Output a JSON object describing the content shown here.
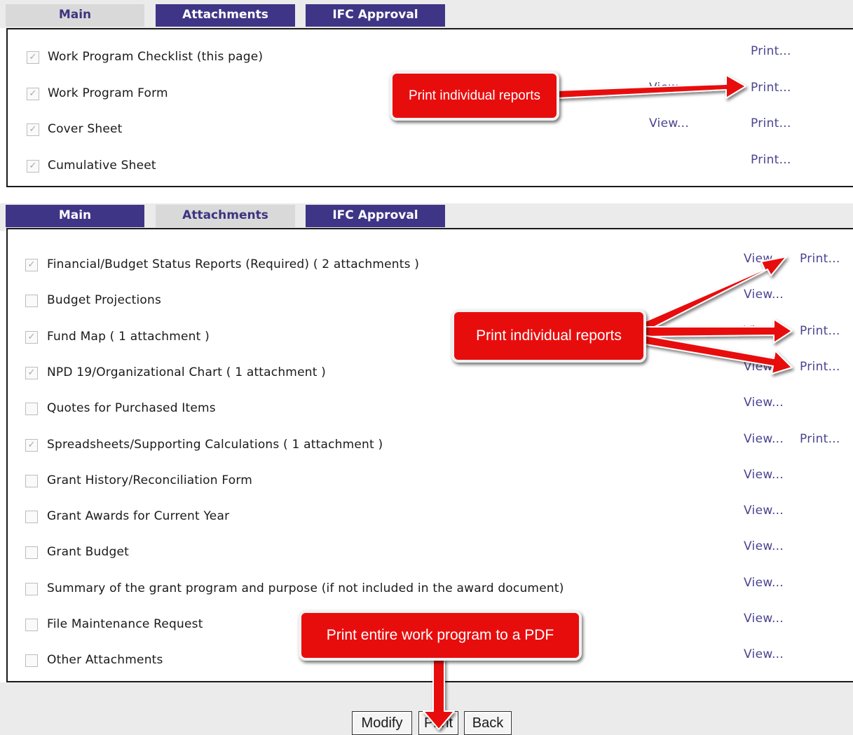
{
  "tabs_top": {
    "main": "Main",
    "attachments": "Attachments",
    "ifc": "IFC Approval",
    "active": "main"
  },
  "tabs_bottom": {
    "main": "Main",
    "attachments": "Attachments",
    "ifc": "IFC Approval",
    "active": "attachments"
  },
  "main_items": [
    {
      "label": "Work Program Checklist (this page)",
      "checked": true,
      "view": "",
      "print": "Print..."
    },
    {
      "label": "Work Program Form",
      "checked": true,
      "view": "View...",
      "print": "Print..."
    },
    {
      "label": "Cover Sheet",
      "checked": true,
      "view": "View...",
      "print": "Print..."
    },
    {
      "label": "Cumulative Sheet",
      "checked": true,
      "view": "",
      "print": "Print..."
    }
  ],
  "attachment_items": [
    {
      "label": "Financial/Budget Status Reports (Required) ( 2 attachments )",
      "checked": true,
      "view": "View...",
      "print": "Print..."
    },
    {
      "label": "Budget Projections",
      "checked": false,
      "view": "View...",
      "print": ""
    },
    {
      "label": "Fund Map ( 1 attachment )",
      "checked": true,
      "view": "View...",
      "print": "Print..."
    },
    {
      "label": "NPD 19/Organizational Chart ( 1 attachment )",
      "checked": true,
      "view": "View...",
      "print": "Print..."
    },
    {
      "label": "Quotes for Purchased Items",
      "checked": false,
      "view": "View...",
      "print": ""
    },
    {
      "label": "Spreadsheets/Supporting Calculations ( 1 attachment )",
      "checked": true,
      "view": "View...",
      "print": "Print..."
    },
    {
      "label": "Grant History/Reconciliation Form",
      "checked": false,
      "view": "View...",
      "print": ""
    },
    {
      "label": "Grant Awards for Current Year",
      "checked": false,
      "view": "View...",
      "print": ""
    },
    {
      "label": "Grant Budget",
      "checked": false,
      "view": "View...",
      "print": ""
    },
    {
      "label": "Summary of the grant program and purpose (if not included in the award document)",
      "checked": false,
      "view": "View...",
      "print": ""
    },
    {
      "label": "File Maintenance Request",
      "checked": false,
      "view": "View...",
      "print": ""
    },
    {
      "label": "Other Attachments",
      "checked": false,
      "view": "View...",
      "print": ""
    }
  ],
  "callouts": {
    "top": "Print individual reports",
    "middle": "Print individual reports",
    "bottom": "Print entire work program to a PDF"
  },
  "buttons": {
    "modify": "Modify",
    "print": "Print",
    "back": "Back"
  },
  "colors": {
    "tab_inactive": "#3f3586",
    "tab_active": "#d9d9d9",
    "link": "#4a4390",
    "callout": "#e80d0d"
  },
  "icons": {
    "checkbox_checked": "checkmark-icon",
    "arrow": "red-arrow-icon"
  }
}
